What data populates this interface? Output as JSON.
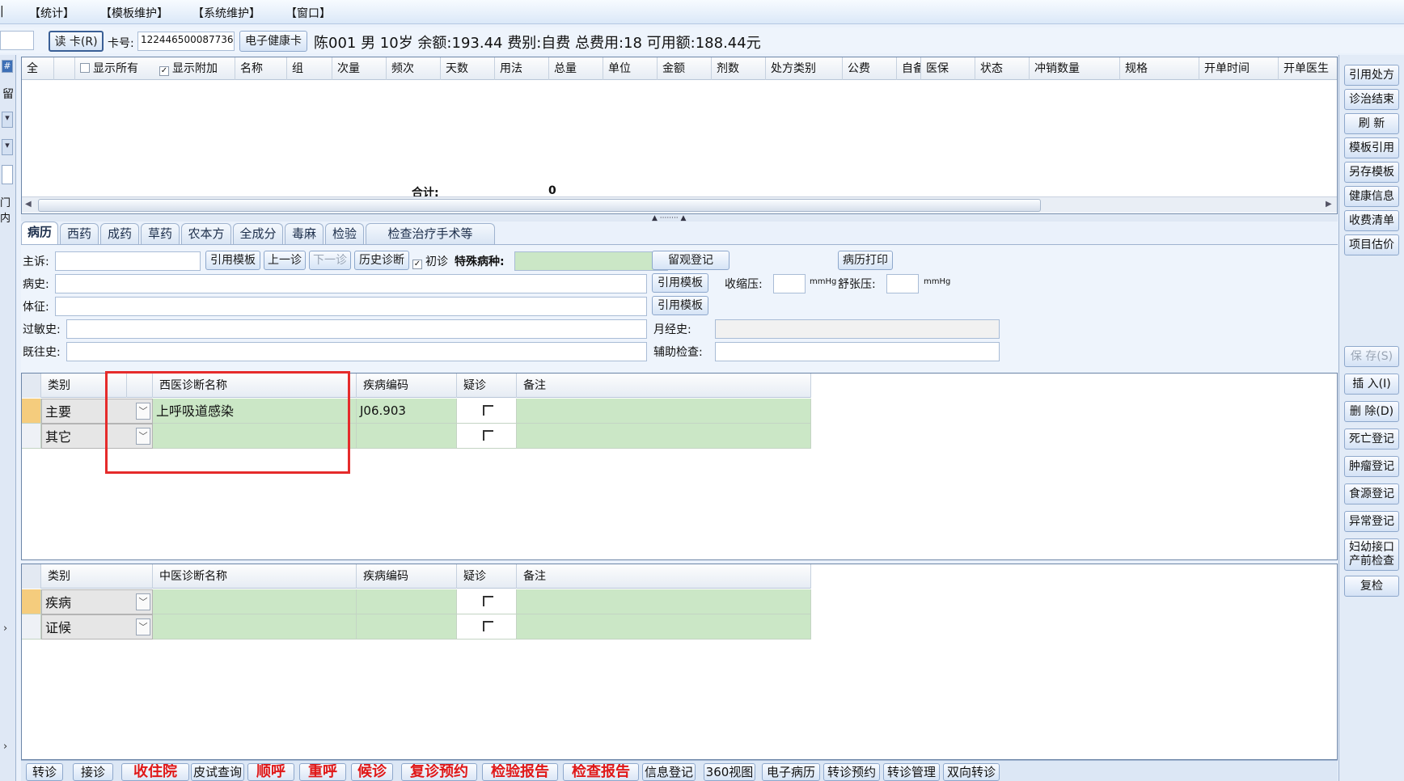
{
  "menu": [
    "【统计】",
    "【模板维护】",
    "【系统维护】",
    "【窗口】"
  ],
  "patient": {
    "read_card": "读 卡(R)",
    "card_label": "卡号:",
    "card_no": "122446500087736",
    "health_card": "电子健康卡",
    "summary": "陈001 男 10岁 余额:193.44 费别:自费 总费用:18 可用额:188.44元"
  },
  "left_strip": {
    "pin": "#",
    "top_label": "留",
    "side_text": "门内"
  },
  "rx_table": {
    "columns": [
      "全",
      "显示所有",
      "显示附加",
      "名称",
      "组",
      "次量",
      "频次",
      "天数",
      "用法",
      "总量",
      "单位",
      "金额",
      "剂数",
      "处方类别",
      "公费",
      "自备",
      "医保",
      "状态",
      "冲销数量",
      "规格",
      "开单时间",
      "开单医生"
    ],
    "total_label": "合计:",
    "total_value": "0"
  },
  "right_buttons": [
    "引用处方",
    "诊治结束",
    "刷 新",
    "模板引用",
    "另存模板",
    "健康信息",
    "收费清单",
    "项目估价"
  ],
  "right_buttons2": [
    "保 存(S)",
    "插 入(I)",
    "删 除(D)",
    "死亡登记",
    "肿瘤登记",
    "食源登记",
    "异常登记",
    "妇幼接口 产前检查",
    "复检"
  ],
  "tabs": [
    "病历",
    "西药",
    "成药",
    "草药",
    "农本方",
    "全成分",
    "毒麻",
    "检验",
    "检查治疗手术等"
  ],
  "form": {
    "chief": "主诉:",
    "cite_tpl": "引用模板",
    "prev": "上一诊",
    "next": "下一诊",
    "history": "历史诊断",
    "first_visit": "初诊",
    "special": "特殊病种:",
    "observe": "留观登记",
    "print": "病历打印",
    "history_label": "病史:",
    "sbp": "收缩压:",
    "unit": "mmHg",
    "dbp": "舒张压:",
    "exam": "体征:",
    "allergy": "过敏史:",
    "menstrual": "月经史:",
    "past": "既往史:",
    "aux": "辅助检查:"
  },
  "west_grid": {
    "headers": [
      "类别",
      "西医诊断名称",
      "疾病编码",
      "疑诊",
      "备注"
    ],
    "rows": [
      {
        "type": "主要",
        "name": "上呼吸道感染",
        "code": "J06.903"
      },
      {
        "type": "其它",
        "name": "",
        "code": ""
      }
    ]
  },
  "tcm_grid": {
    "headers": [
      "类别",
      "中医诊断名称",
      "疾病编码",
      "疑诊",
      "备注"
    ],
    "rows": [
      {
        "type": "疾病",
        "name": "",
        "code": ""
      },
      {
        "type": "证候",
        "name": "",
        "code": ""
      }
    ]
  },
  "bottom": [
    "转诊",
    "接诊",
    "收住院",
    "皮试查询",
    "顺呼",
    "重呼",
    "候诊",
    "复诊预约",
    "检验报告",
    "检查报告",
    "信息登记",
    "360视图",
    "电子病历",
    "转诊预约",
    "转诊管理",
    "双向转诊"
  ]
}
